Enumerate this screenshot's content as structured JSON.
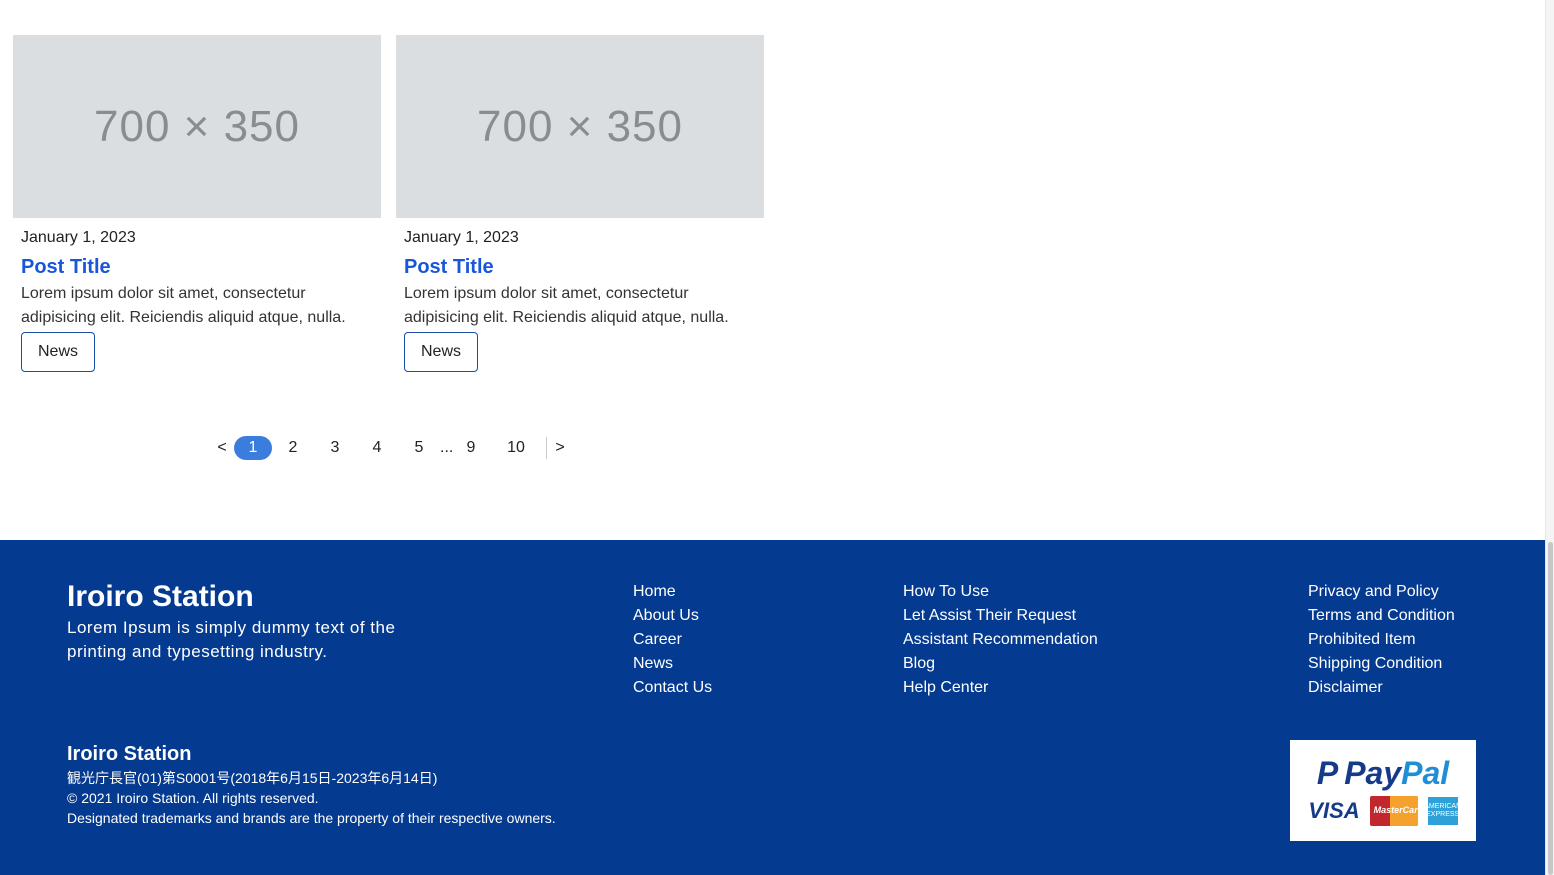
{
  "posts": [
    {
      "image_placeholder": "700 × 350",
      "date": "January 1, 2023",
      "title": "Post Title",
      "excerpt": "Lorem ipsum dolor sit amet, consectetur adipisicing elit. Reiciendis aliquid atque, nulla.",
      "tag": "News"
    },
    {
      "image_placeholder": "700 × 350",
      "date": "January 1, 2023",
      "title": "Post Title",
      "excerpt": "Lorem ipsum dolor sit amet, consectetur adipisicing elit. Reiciendis aliquid atque, nulla.",
      "tag": "News"
    }
  ],
  "pagination": {
    "prev": "<",
    "pages": [
      "1",
      "2",
      "3",
      "4",
      "5"
    ],
    "ellipsis": "...",
    "tail_pages": [
      "9",
      "10"
    ],
    "next": ">",
    "current": "1"
  },
  "footer": {
    "brand": "Iroiro Station",
    "description": "Lorem Ipsum is simply dummy text of the printing and typesetting industry.",
    "col1": [
      "Home",
      "About Us",
      "Career",
      "News",
      "Contact Us"
    ],
    "col2": [
      "How To Use",
      "Let Assist Their Request",
      "Assistant Recommendation",
      "Blog",
      "Help Center"
    ],
    "col3": [
      "Privacy and Policy",
      "Terms and Condition",
      "Prohibited Item",
      "Shipping Condition",
      "Disclaimer"
    ],
    "brand2": "Iroiro Station",
    "license": "観光庁長官(01)第S0001号(2018年6月15日-2023年6月14日)",
    "copyright": "© 2021 Iroiro Station. All rights reserved.",
    "trademark": "Designated trademarks and brands are the property of their respective owners.",
    "payment": {
      "paypal_mark": "P",
      "paypal_pay": "Pay",
      "paypal_pal": "Pal",
      "visa": "VISA",
      "mastercard": "MasterCard",
      "amex": "AMERICAN EXPRESS"
    }
  }
}
